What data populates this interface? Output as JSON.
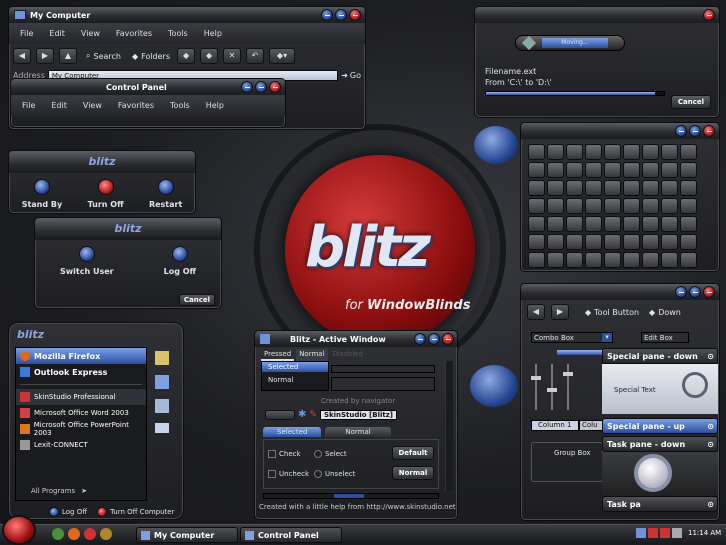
{
  "wallpaper": {
    "logo": "blitz",
    "subtitle_for": "for",
    "subtitle_product": "WindowBlinds"
  },
  "my_computer": {
    "title": "My Computer",
    "menus": [
      "File",
      "Edit",
      "View",
      "Favorites",
      "Tools",
      "Help"
    ],
    "search": "Search",
    "folders": "Folders",
    "address_label": "Address",
    "address_value": "My Computer",
    "go": "Go"
  },
  "control_panel": {
    "title": "Control Panel",
    "menus": [
      "File",
      "Edit",
      "View",
      "Favorites",
      "Tools",
      "Help"
    ]
  },
  "shutdown": {
    "stand_by": "Stand By",
    "turn_off": "Turn Off",
    "restart": "Restart"
  },
  "logoff": {
    "switch_user": "Switch User",
    "log_off": "Log Off",
    "cancel": "Cancel"
  },
  "start_menu": {
    "items": [
      "Mozilla Firefox",
      "Outlook Express",
      "SkinStudio Professional",
      "Microsoft Office Word 2003",
      "Microsoft Office PowerPoint 2003",
      "Lexit-CONNECT"
    ],
    "all_programs": "All Programs",
    "log_off": "Log Off",
    "turn_off": "Turn Off Computer"
  },
  "copy_dialog": {
    "progress_label": "Moving...",
    "filename": "Filename.ext",
    "from_to": "From 'C:\\' to 'D:\\'",
    "cancel": "Cancel",
    "progress": 0.95
  },
  "active_window": {
    "title": "Blitz - Active Window",
    "tab_pressed": "Pressed",
    "tab_normal": "Normal",
    "tab_third": "Disabled",
    "list_selected": "Selected",
    "list_normal": "Normal",
    "created_by": "Created by navigator",
    "skinstudio": "SkinStudio [Blitz]",
    "tab2_selected": "Selected",
    "tab2_normal": "Normal",
    "check": "Check",
    "select": "Select",
    "uncheck": "Uncheck",
    "unselect": "Unselect",
    "default_btn": "Default",
    "normal_btn": "Normal",
    "footer": "Created with a little help from http://www.skinstudio.net"
  },
  "controls": {
    "tool_button": "Tool Button",
    "down": "Down",
    "combo_box": "Combo Box",
    "edit_box": "Edit Box",
    "column1": "Column 1",
    "column2": "Colu",
    "group_box": "Group Box"
  },
  "special_panes": {
    "pane_down": "Special pane - down",
    "special_text": "Special Text",
    "pane_up": "Special pane - up",
    "task_down": "Task pane - down",
    "task_up": "Task pa"
  },
  "taskbar": {
    "tasks": [
      "My Computer",
      "Control Panel"
    ],
    "clock": "11:14 AM"
  },
  "colors": {
    "accent_blue": "#2c4f9e",
    "accent_red": "#b01818"
  }
}
